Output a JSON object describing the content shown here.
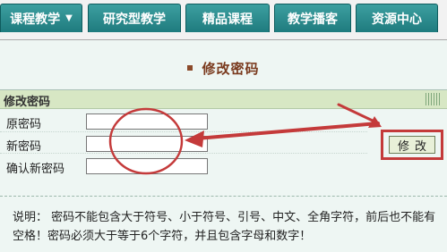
{
  "nav": {
    "tabs": [
      {
        "label": "课程教学",
        "has_dropdown": true
      },
      {
        "label": "研究型教学"
      },
      {
        "label": "精品课程"
      },
      {
        "label": "教学播客"
      },
      {
        "label": "资源中心"
      }
    ]
  },
  "page": {
    "title": "修改密码"
  },
  "form": {
    "header": "修改密码",
    "fields": [
      {
        "label": "原密码",
        "value": ""
      },
      {
        "label": "新密码",
        "value": ""
      },
      {
        "label": "确认新密码",
        "value": ""
      }
    ],
    "submit_label": "修改"
  },
  "note": {
    "text": "说明：  密码不能包含大于符号、小于符号、引号、中文、全角字符，前后也不能有空格！密码必须大于等于6个字符，并且包含字母和数字！"
  },
  "colors": {
    "tab_bg": "#1f7b7e",
    "annotation_red": "#c43a3a",
    "title_brown": "#7a3a1e"
  }
}
